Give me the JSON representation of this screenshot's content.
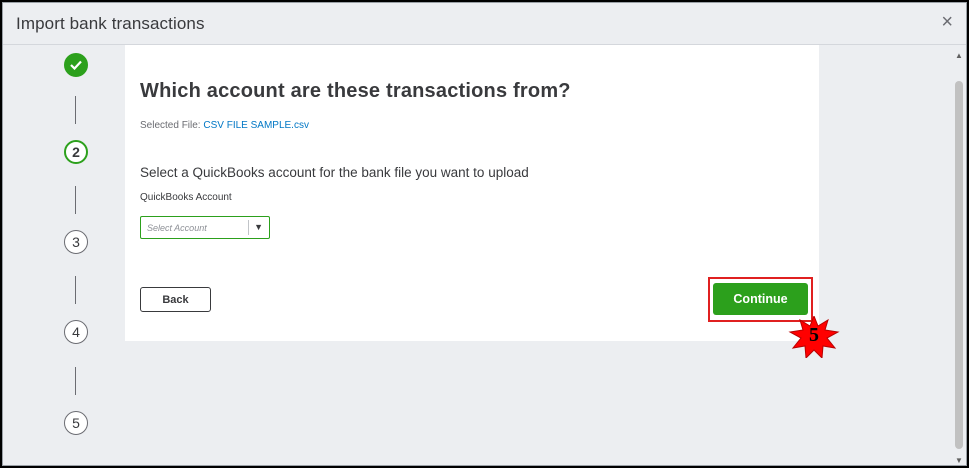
{
  "dialog": {
    "title": "Import bank transactions",
    "close_glyph": "×"
  },
  "stepper": {
    "steps": [
      {
        "label": "",
        "state": "done"
      },
      {
        "label": "2",
        "state": "active"
      },
      {
        "label": "3",
        "state": "pending"
      },
      {
        "label": "4",
        "state": "pending"
      },
      {
        "label": "5",
        "state": "pending"
      }
    ]
  },
  "main": {
    "heading": "Which account are these transactions from?",
    "selected_file_label": "Selected File:",
    "selected_file_name": "CSV FILE SAMPLE.csv",
    "instruction": "Select a QuickBooks account for the bank file you want to upload",
    "account_field_label": "QuickBooks Account",
    "account_placeholder": "Select Account",
    "back_label": "Back",
    "continue_label": "Continue"
  },
  "annotation": {
    "step_number": "5",
    "highlight_color": "#e02020",
    "badge_color": "#ff0000"
  },
  "colors": {
    "accent": "#2ca01c",
    "link": "#0077c5"
  },
  "icons": {
    "close": "close-icon",
    "step_done": "checkmark-icon",
    "dropdown": "caret-down-icon"
  }
}
